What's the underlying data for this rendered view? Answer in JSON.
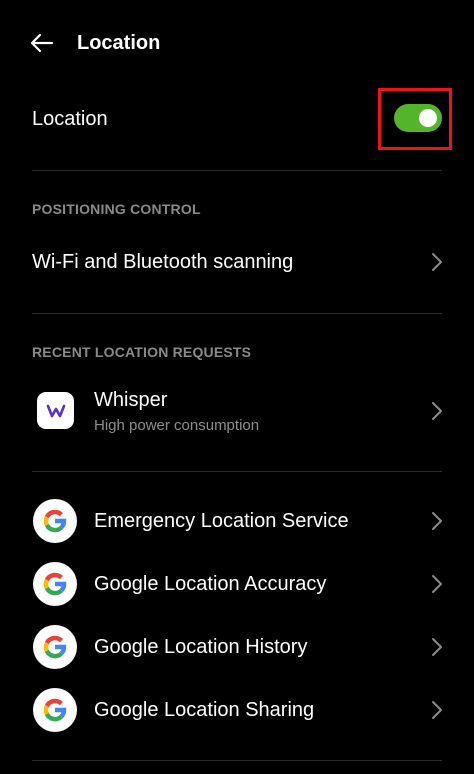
{
  "header": {
    "title": "Location",
    "back_icon": "arrow-left-icon"
  },
  "location_toggle": {
    "label": "Location",
    "state": "on",
    "color_on": "#54b42c",
    "highlight_color": "#e8161b"
  },
  "positioning_control": {
    "header": "POSITIONING CONTROL",
    "items": [
      {
        "label": "Wi-Fi and Bluetooth scanning",
        "icon": "chevron-right-icon"
      }
    ]
  },
  "recent_requests": {
    "header": "RECENT LOCATION REQUESTS",
    "items": [
      {
        "label": "Whisper",
        "subtitle": "High power consumption",
        "icon": "whisper-app-icon",
        "icon_color": "#5b2ec7"
      }
    ]
  },
  "services": {
    "items": [
      {
        "label": "Emergency Location Service",
        "icon": "google-icon"
      },
      {
        "label": "Google Location Accuracy",
        "icon": "google-icon"
      },
      {
        "label": "Google Location History",
        "icon": "google-icon"
      },
      {
        "label": "Google Location Sharing",
        "icon": "google-icon"
      }
    ]
  },
  "colors": {
    "background": "#000000",
    "text_primary": "#ffffff",
    "text_secondary": "#8e8e8e",
    "section_header": "#8a8a8a",
    "divider": "#2b2b2b"
  }
}
